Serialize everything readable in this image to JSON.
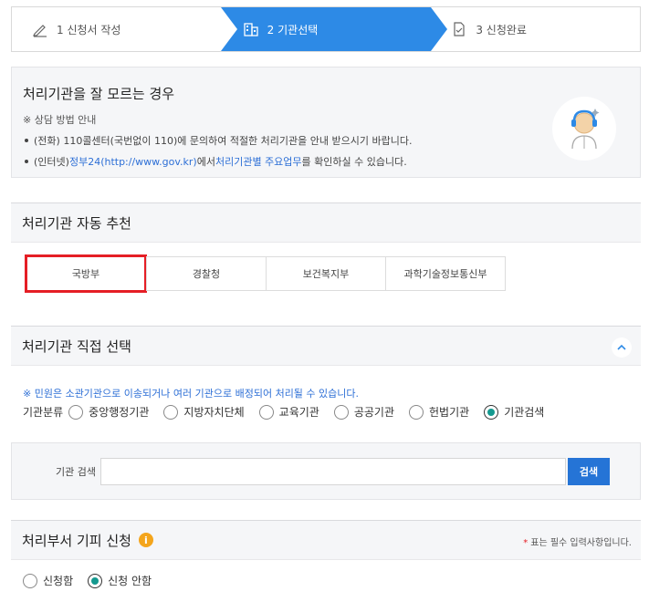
{
  "steps": [
    {
      "label": "1 신청서 작성",
      "icon": "pencil-icon"
    },
    {
      "label": "2 기관선택",
      "icon": "building-icon"
    },
    {
      "label": "3 신청완료",
      "icon": "document-check-icon"
    }
  ],
  "info": {
    "title": "처리기관을 잘 모르는 경우",
    "note": "※ 상담 방법 안내",
    "line1": "(전화) 110콜센터(국번없이 110)에 문의하여 적절한 처리기관을 안내 받으시기 바랍니다.",
    "line2_prefix": "(인터넷) ",
    "line2_link1": "정부24(http://www.gov.kr)",
    "line2_mid": "에서 ",
    "line2_link2": "처리기관별 주요업무",
    "line2_suffix": "를 확인하실 수 있습니다."
  },
  "recommend": {
    "title": "처리기관 자동 추천",
    "items": [
      "국방부",
      "경찰청",
      "보건복지부",
      "과학기술정보통신부"
    ]
  },
  "direct": {
    "title": "처리기관 직접 선택",
    "notice": "※ 민원은 소관기관으로 이송되거나 여러 기관으로 배정되어 처리될 수 있습니다.",
    "category_label": "기관분류",
    "options": [
      "중앙행정기관",
      "지방자치단체",
      "교육기관",
      "공공기관",
      "헌법기관",
      "기관검색"
    ],
    "selected": "기관검색"
  },
  "search": {
    "label": "기관 검색",
    "value": "",
    "button": "검색"
  },
  "avoid": {
    "title": "처리부서 기피 신청",
    "badge": "i",
    "required_star": "*",
    "required_note": "표는 필수 입력사항입니다.",
    "options": [
      "신청함",
      "신청 안함"
    ],
    "selected": "신청 안함"
  },
  "colors": {
    "active_step": "#2d8ae6",
    "highlight": "#e51e25",
    "radio_dot": "#14998f",
    "search_button": "#2574d6",
    "badge": "#f4a51c"
  }
}
